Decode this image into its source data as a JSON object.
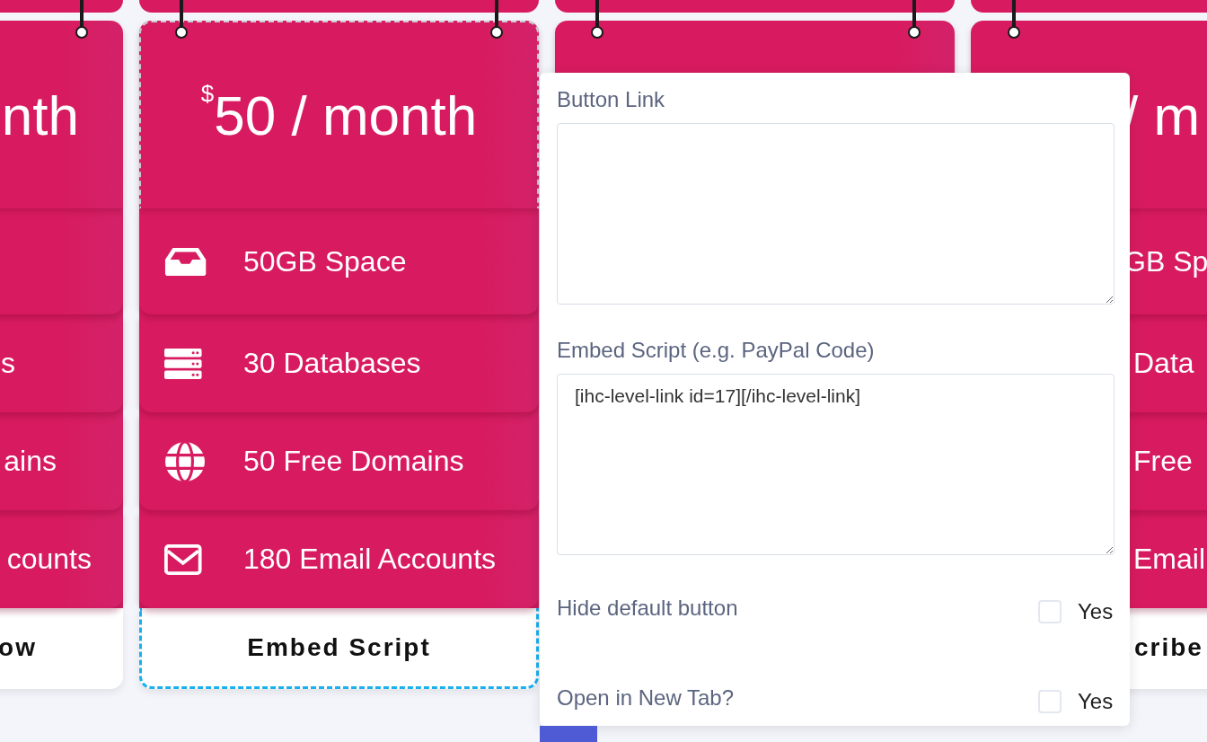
{
  "pricing_cards": [
    {
      "selected": false,
      "price": "nth",
      "features": [
        {
          "text": "s"
        },
        {
          "text": "ains"
        },
        {
          "text": "counts"
        }
      ],
      "footer": "ow"
    },
    {
      "selected": true,
      "currency": "$",
      "price": "50 / month",
      "features": [
        {
          "text": "50GB Space"
        },
        {
          "text": "30 Databases"
        },
        {
          "text": "50 Free Domains"
        },
        {
          "text": "180 Email Accounts"
        }
      ],
      "footer": "Embed Script"
    },
    {
      "selected": false
    },
    {
      "selected": false,
      "price": "/ m",
      "features": [
        {
          "text": "GB Sp"
        },
        {
          "text": "Data"
        },
        {
          "text": "Free"
        },
        {
          "text": "Email"
        }
      ],
      "footer": "cribe"
    }
  ],
  "settings_panel": {
    "fields": [
      {
        "kind": "textarea",
        "label": "Button Link"
      },
      {
        "kind": "textarea",
        "label": "Embed Script (e.g. PayPal Code)",
        "value": "[ihc-level-link id=17][/ihc-level-link]"
      },
      {
        "kind": "checkbox",
        "label": "Hide default button",
        "option": "Yes",
        "checked": false
      },
      {
        "kind": "checkbox",
        "label": "Open in New Tab?",
        "option": "Yes",
        "checked": false
      }
    ]
  }
}
